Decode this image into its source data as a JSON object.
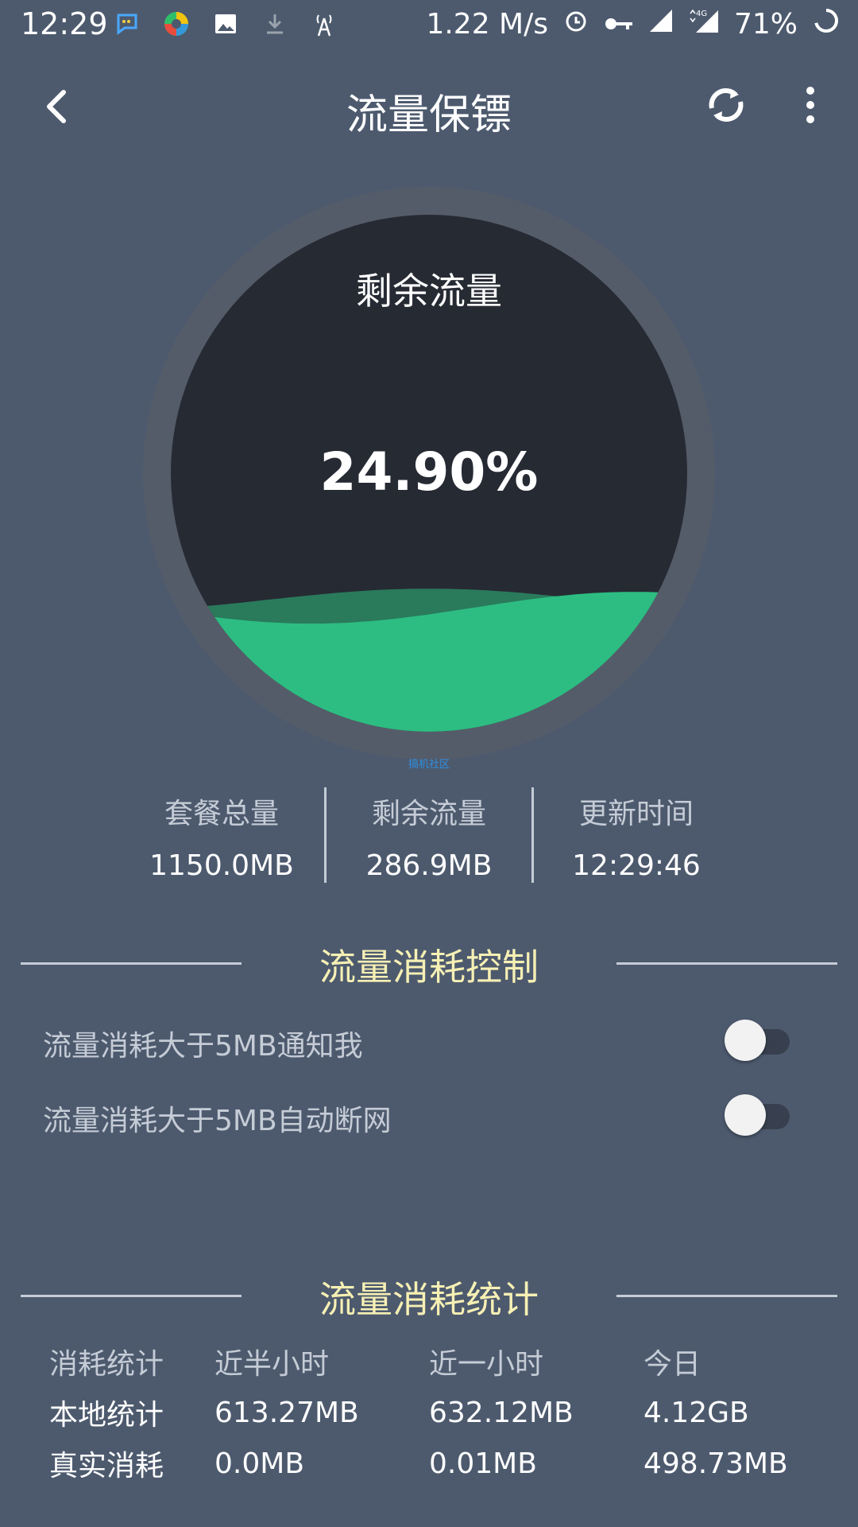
{
  "status_bar": {
    "time": "12:29",
    "speed": "1.22 M/s",
    "network": "4G",
    "battery": "71%",
    "icons_left": [
      "chat-bubble-icon",
      "colorful-app-icon",
      "image-icon",
      "download-icon",
      "signal-tower-icon"
    ],
    "icons_right": [
      "alarm-icon",
      "key-icon",
      "signal-icon",
      "signal-4g-icon",
      "battery-ring-icon"
    ]
  },
  "app_bar": {
    "title": "流量保镖",
    "back_icon": "chevron-left-icon",
    "sync_icon": "sync-icon",
    "more_icon": "more-vertical-icon"
  },
  "gauge": {
    "label": "剩余流量",
    "percent_text": "24.90%",
    "fill_fraction": 0.249,
    "colors": {
      "ring": "#555c69",
      "inner": "#262a33",
      "wave_front": "#2dbd82",
      "wave_back": "#2a7a5c"
    }
  },
  "watermark": "搞机社区",
  "stats": [
    {
      "label": "套餐总量",
      "value": "1150.0MB"
    },
    {
      "label": "剩余流量",
      "value": "286.9MB"
    },
    {
      "label": "更新时间",
      "value": "12:29:46"
    }
  ],
  "control_section": {
    "title": "流量消耗控制",
    "toggles": [
      {
        "label": "流量消耗大于5MB通知我",
        "on": false
      },
      {
        "label": "流量消耗大于5MB自动断网",
        "on": false
      }
    ]
  },
  "stats_section": {
    "title": "流量消耗统计",
    "header": [
      "消耗统计",
      "近半小时",
      "近一小时",
      "今日"
    ],
    "rows": [
      [
        "本地统计",
        "613.27MB",
        "632.12MB",
        "4.12GB"
      ],
      [
        "真实消耗",
        "0.0MB",
        "0.01MB",
        "498.73MB"
      ]
    ]
  },
  "colors": {
    "background": "#4d5a6e",
    "section_title": "#f6f0b4",
    "accent_green": "#2dbd82"
  }
}
